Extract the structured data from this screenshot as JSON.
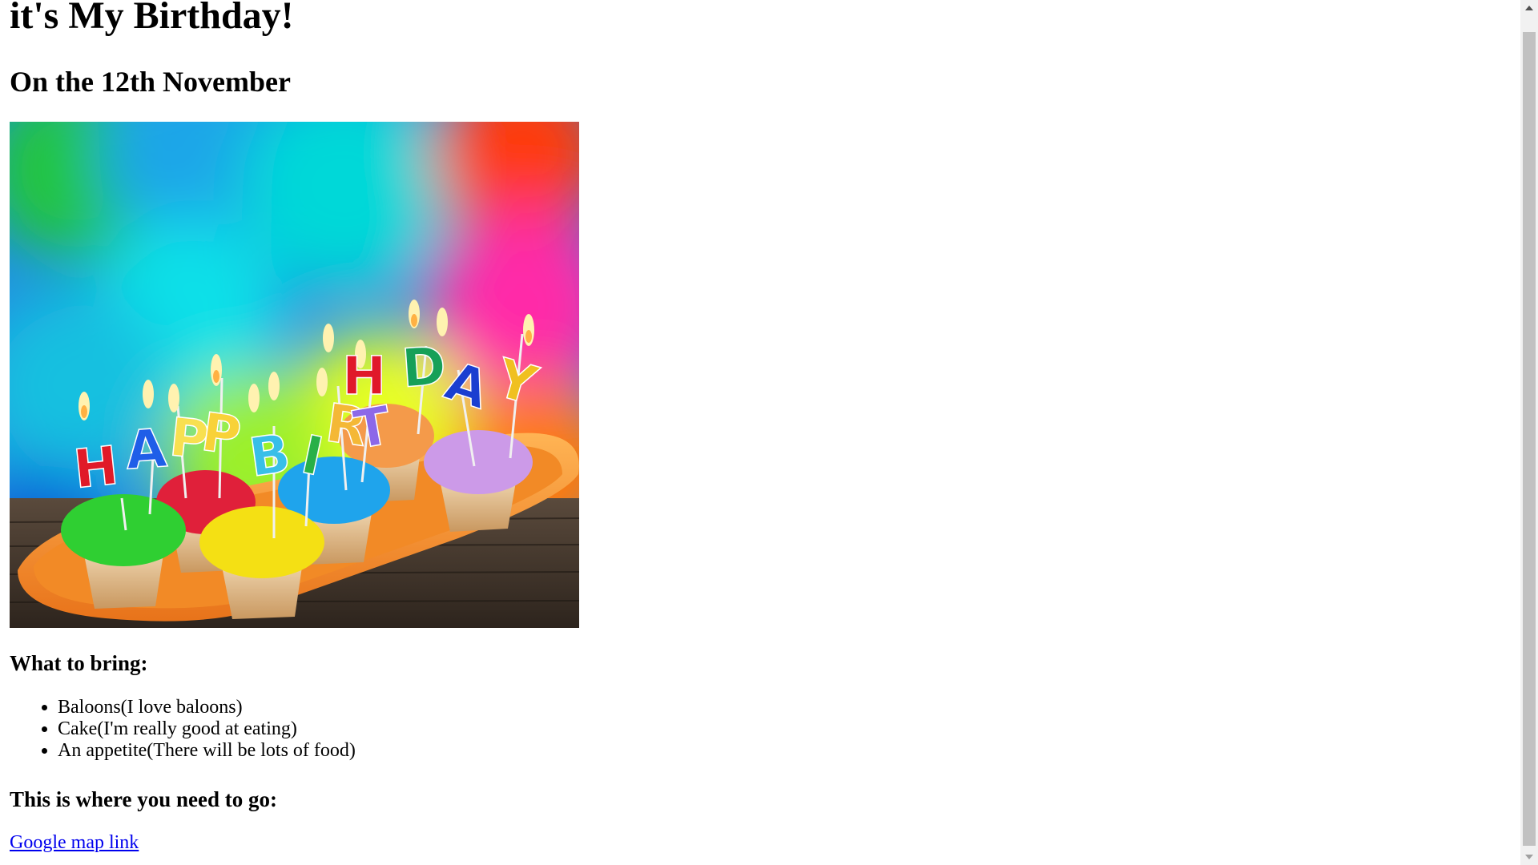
{
  "page": {
    "title": "it's My Birthday!",
    "date_heading": "On the 12th November",
    "photo_alt": "Happy Birthday cupcakes with candles",
    "bring_heading": "What to bring:",
    "bring_items": [
      "Baloons(I love baloons)",
      "Cake(I'm really good at eating)",
      "An appetite(There will be lots of food)"
    ],
    "where_heading": "This is where you need to go:",
    "map_link_label": "Google map link"
  },
  "colors": {
    "link": "#0000ee",
    "scrollbar_track": "#f1f1f1",
    "scrollbar_thumb": "#c1c1c1"
  },
  "icons": {
    "scroll_up": "scroll-up-arrow-icon",
    "scroll_down": "scroll-down-arrow-icon"
  }
}
